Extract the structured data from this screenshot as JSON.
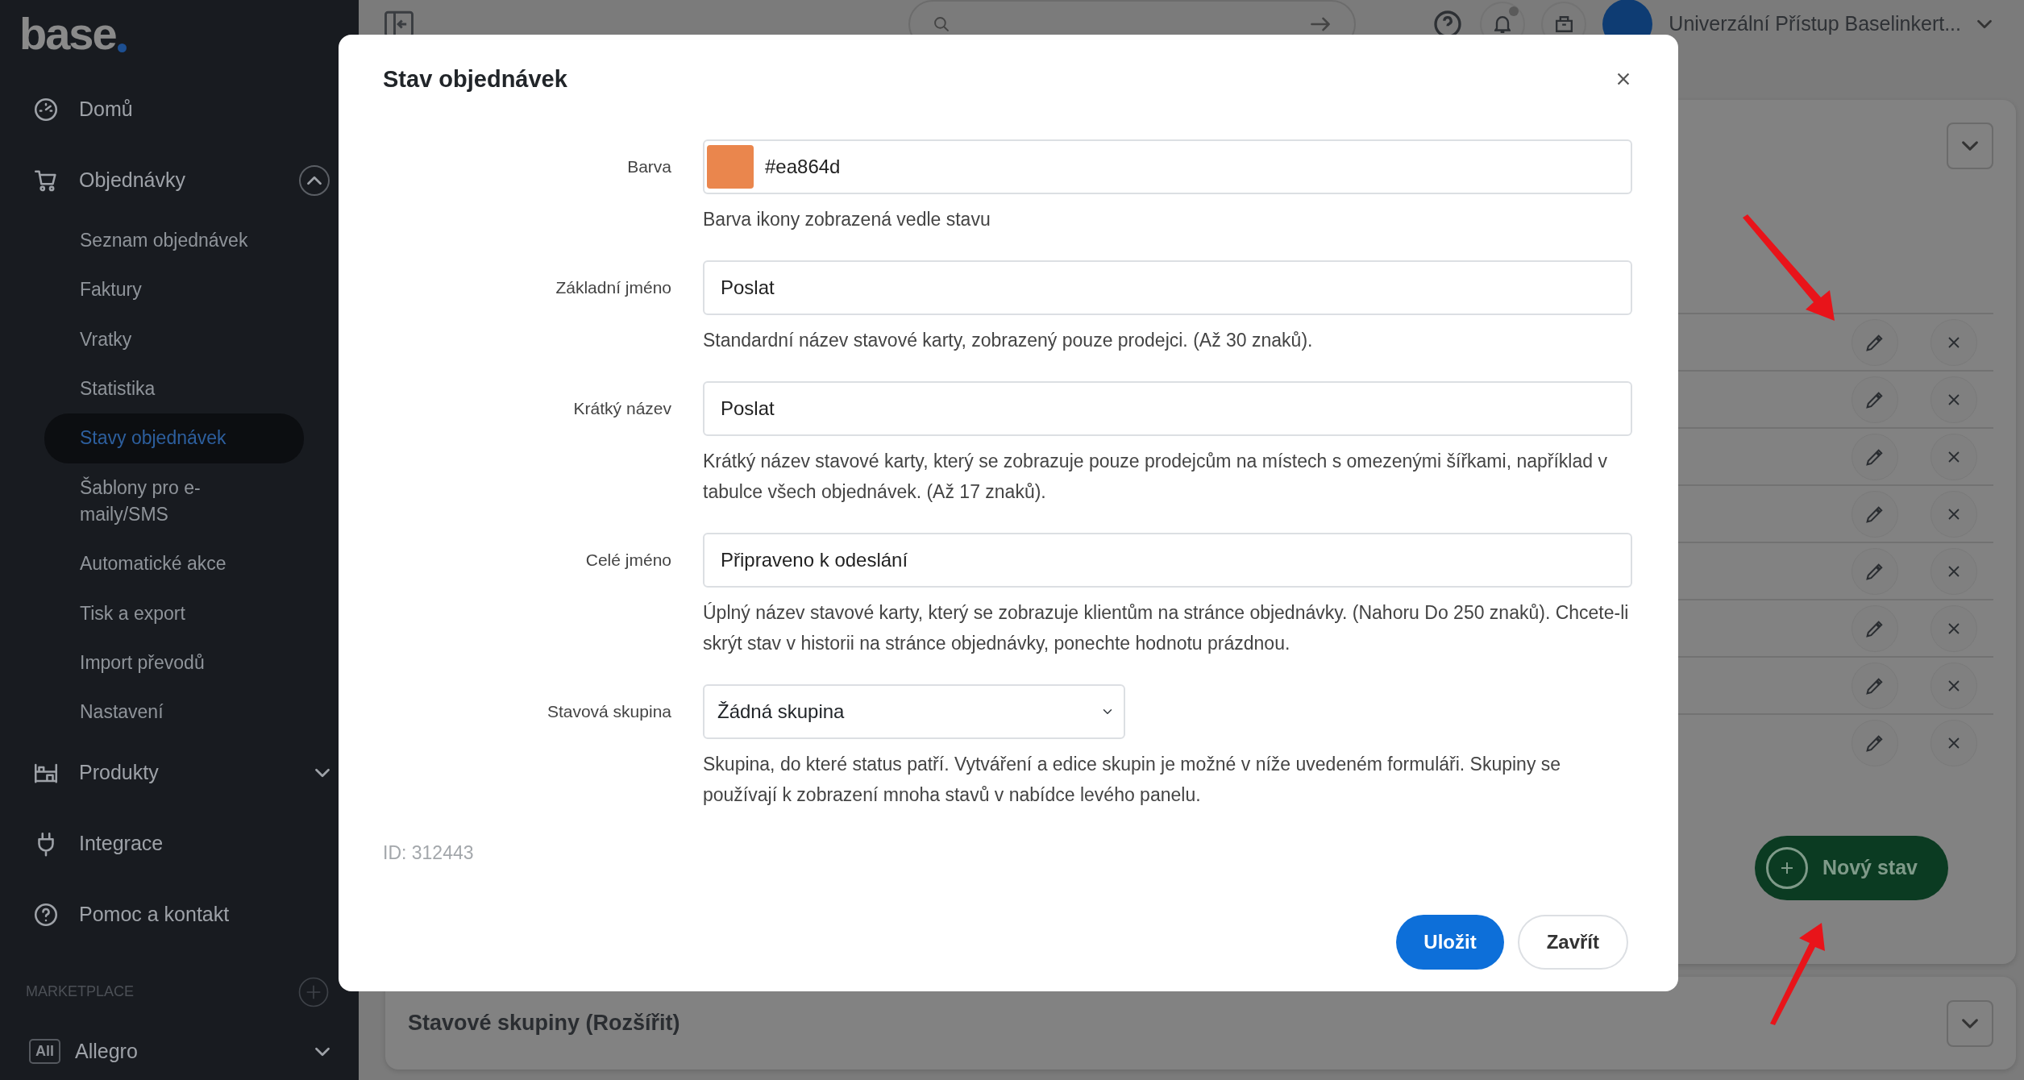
{
  "sidebar": {
    "logo": "base",
    "items": [
      {
        "kind": "link",
        "label": "Domů"
      },
      {
        "kind": "group",
        "label": "Objednávky",
        "expanded": true,
        "children": [
          {
            "label": "Seznam objednávek",
            "selected": false
          },
          {
            "label": "Faktury",
            "selected": false
          },
          {
            "label": "Vratky",
            "selected": false
          },
          {
            "label": "Statistika",
            "selected": false
          },
          {
            "label": "Stavy objednávek",
            "selected": true
          },
          {
            "label": "Šablony pro e-maily/SMS",
            "selected": false
          },
          {
            "label": "Automatické akce",
            "selected": false
          },
          {
            "label": "Tisk a export",
            "selected": false
          },
          {
            "label": "Import převodů",
            "selected": false
          },
          {
            "label": "Nastavení",
            "selected": false
          }
        ]
      },
      {
        "kind": "group",
        "label": "Produkty",
        "expanded": false
      },
      {
        "kind": "link",
        "label": "Integrace"
      },
      {
        "kind": "link",
        "label": "Pomoc a kontakt"
      }
    ],
    "marketplace": {
      "heading": "MARKETPLACE",
      "items": [
        {
          "badge": "All",
          "label": "Allegro",
          "expanded": false
        }
      ]
    }
  },
  "topbar": {
    "notification_dot": true,
    "user": "Univerzální Přístup Baselinkert..."
  },
  "statuses_card": {
    "new_button": "Nový stav"
  },
  "groups_card": {
    "title": "Stavové skupiny (Rozšířit)"
  },
  "modal": {
    "title": "Stav objednávek",
    "fields": [
      {
        "kind": "color",
        "label": "Barva",
        "value": "#ea864d",
        "color": "#ea864d",
        "help": "Barva ikony zobrazená vedle stavu"
      },
      {
        "kind": "text",
        "label": "Základní jméno",
        "value": "Poslat",
        "help": "Standardní název stavové karty, zobrazený pouze prodejci. (Až 30 znaků)."
      },
      {
        "kind": "text",
        "label": "Krátký název",
        "value": "Poslat",
        "help": "Krátký název stavové karty, který se zobrazuje pouze prodejcům na místech s omezenými šířkami, například v tabulce všech objednávek. (Až 17 znaků)."
      },
      {
        "kind": "text",
        "label": "Celé jméno",
        "value": "Připraveno k odeslání",
        "help": "Úplný název stavové karty, který se zobrazuje klientům na stránce objednávky. (Nahoru Do 250 znaků). Chcete-li skrýt stav v historii na stránce objednávky, ponechte hodnotu prázdnou."
      },
      {
        "kind": "select",
        "label": "Stavová skupina",
        "value": "Žádná skupina",
        "help": "Skupina, do které status patří. Vytváření a edice skupin je možné v níže uvedeném formuláři. Skupiny se používají k zobrazení mnoha stavů v nabídce levého panelu."
      }
    ],
    "id_text": "ID: 312443",
    "buttons": [
      {
        "kind": "primary",
        "label": "Uložit"
      },
      {
        "kind": "secondary",
        "label": "Zavřít"
      }
    ]
  }
}
